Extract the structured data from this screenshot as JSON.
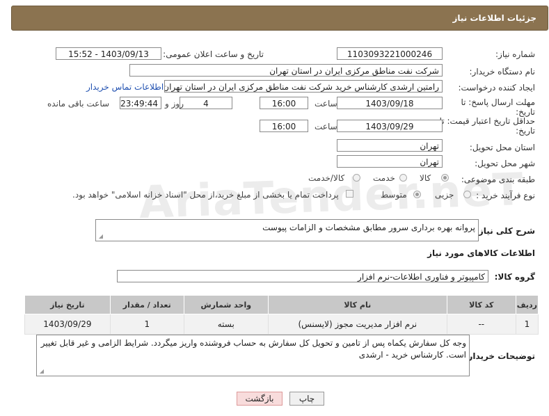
{
  "header": {
    "title": "جزئیات اطلاعات نیاز"
  },
  "fields": {
    "need_number_label": "شماره نیاز:",
    "need_number": "1103093221000246",
    "announce_label": "تاریخ و ساعت اعلان عمومی:",
    "announce_value": "1403/09/13 - 15:52",
    "buyer_org_label": "نام دستگاه خریدار:",
    "buyer_org": "شرکت نفت مناطق مرکزی ایران در استان تهران",
    "creator_label": "ایجاد کننده درخواست:",
    "creator": "رامتین ارشدی کارشناس خرید شرکت نفت مناطق مرکزی ایران در استان تهران",
    "contact_link": "اطلاعات تماس خریدار",
    "deadline_label_1": "مهلت ارسال پاسخ: تا",
    "deadline_label_2": "تاریخ:",
    "deadline_date": "1403/09/18",
    "time_label": "ساعت",
    "deadline_time": "16:00",
    "days_value": "4",
    "days_label": "روز و",
    "remaining_value": "23:49:44",
    "remaining_label": "ساعت باقی مانده",
    "validity_label_1": "حداقل تاریخ اعتبار قیمت: تا",
    "validity_label_2": "تاریخ:",
    "validity_date": "1403/09/29",
    "validity_time": "16:00",
    "province_label": "استان محل تحویل:",
    "province": "تهران",
    "city_label": "شهر محل تحویل:",
    "city": "تهران",
    "category_label": "طبقه بندی موضوعی:",
    "category_options": [
      "کالا",
      "خدمت",
      "کالا/خدمت"
    ],
    "process_label": "نوع فرآیند خرید :",
    "process_options": [
      "جزیی",
      "متوسط"
    ],
    "payment_note": "پرداخت تمام یا بخشی از مبلغ خرید،از محل \"اسناد خزانه اسلامی\" خواهد بود."
  },
  "description": {
    "label": "شرح کلی نیاز:",
    "value": "پروانه بهره برداری سرور مطابق مشخصات و الزامات پیوست"
  },
  "goods": {
    "section_title": "اطلاعات کالاهای مورد نیاز",
    "group_label": "گروه کالا:",
    "group_value": "کامپیوتر و فناوری اطلاعات-نرم افزار",
    "columns": [
      "ردیف",
      "کد کالا",
      "نام کالا",
      "واحد شمارش",
      "تعداد / مقدار",
      "تاریخ نیاز"
    ],
    "rows": [
      [
        "1",
        "--",
        "نرم افزار مدیریت مجوز (لایسنس)",
        "بسته",
        "1",
        "1403/09/29"
      ]
    ]
  },
  "buyer_notes": {
    "label": "توضیحات خریدار:",
    "value": "وجه کل سفارش یکماه پس از تامین و تحویل کل سفارش به حساب فروشنده واریز میگردد. شرایط الزامی و غیر قابل تغییر است. کارشناس خرید - ارشدی"
  },
  "buttons": {
    "print": "چاپ",
    "back": "بازگشت"
  },
  "watermark": "AriaTender.neT"
}
